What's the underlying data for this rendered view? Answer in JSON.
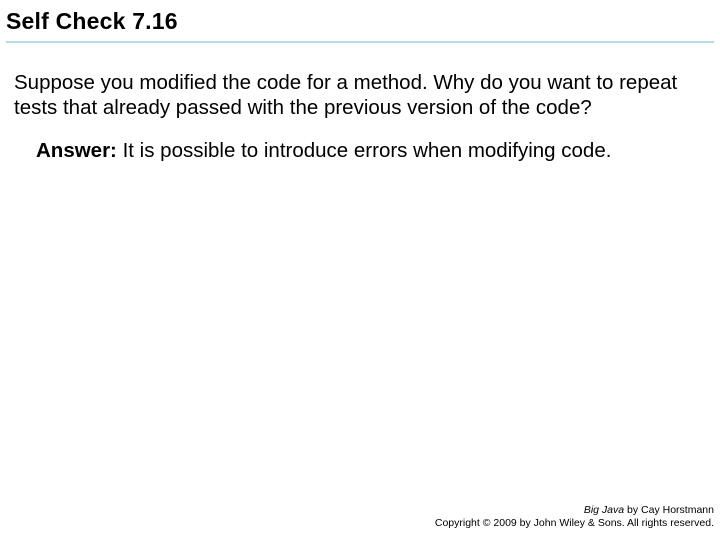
{
  "title": "Self Check 7.16",
  "question": "Suppose you modified the code for a method. Why do you want to repeat tests that already passed with the previous version of the code?",
  "answer_label": "Answer:",
  "answer_text": " It is possible to introduce errors when modifying code.",
  "footer": {
    "book_title": "Big Java",
    "byline": " by Cay Horstmann",
    "copyright": "Copyright © 2009 by John Wiley & Sons. All rights reserved."
  }
}
